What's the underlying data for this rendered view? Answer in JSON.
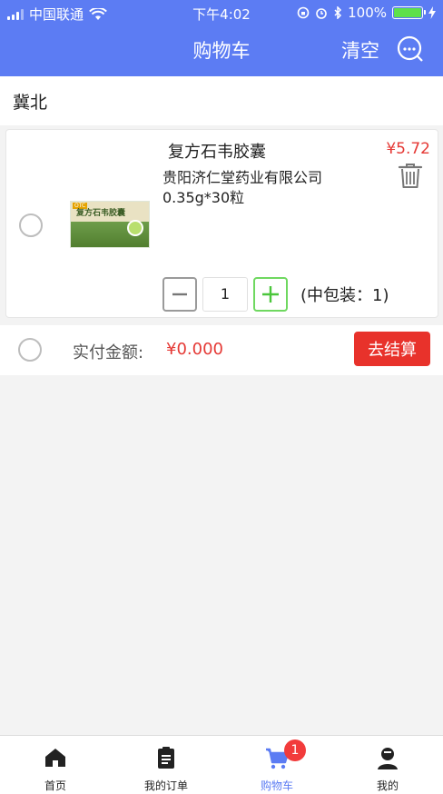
{
  "status_bar": {
    "carrier": "中国联通",
    "time": "下午4:02",
    "battery": "100%"
  },
  "nav": {
    "title": "购物车",
    "clear_label": "清空"
  },
  "region": "冀北",
  "cart_item": {
    "name": "复方石韦胶囊",
    "manufacturer": "贵阳济仁堂药业有限公司",
    "spec": "0.35g*30粒",
    "price": "¥5.72",
    "quantity": "1",
    "package_note": "(中包装：1)",
    "image_text": "复方石韦胶囊"
  },
  "summary": {
    "pay_label": "实付金额:",
    "pay_amount": "¥0.000",
    "checkout_label": "去结算"
  },
  "tabbar": [
    {
      "label": "首页",
      "icon": "home-icon"
    },
    {
      "label": "我的订单",
      "icon": "order-icon"
    },
    {
      "label": "购物车",
      "icon": "cart-icon",
      "badge": "1",
      "active": true
    },
    {
      "label": "我的",
      "icon": "user-icon"
    }
  ],
  "colors": {
    "primary": "#5c7cf3",
    "price_red": "#e53935",
    "checkout_red": "#e8322b",
    "plus_green": "#4bc63c"
  }
}
